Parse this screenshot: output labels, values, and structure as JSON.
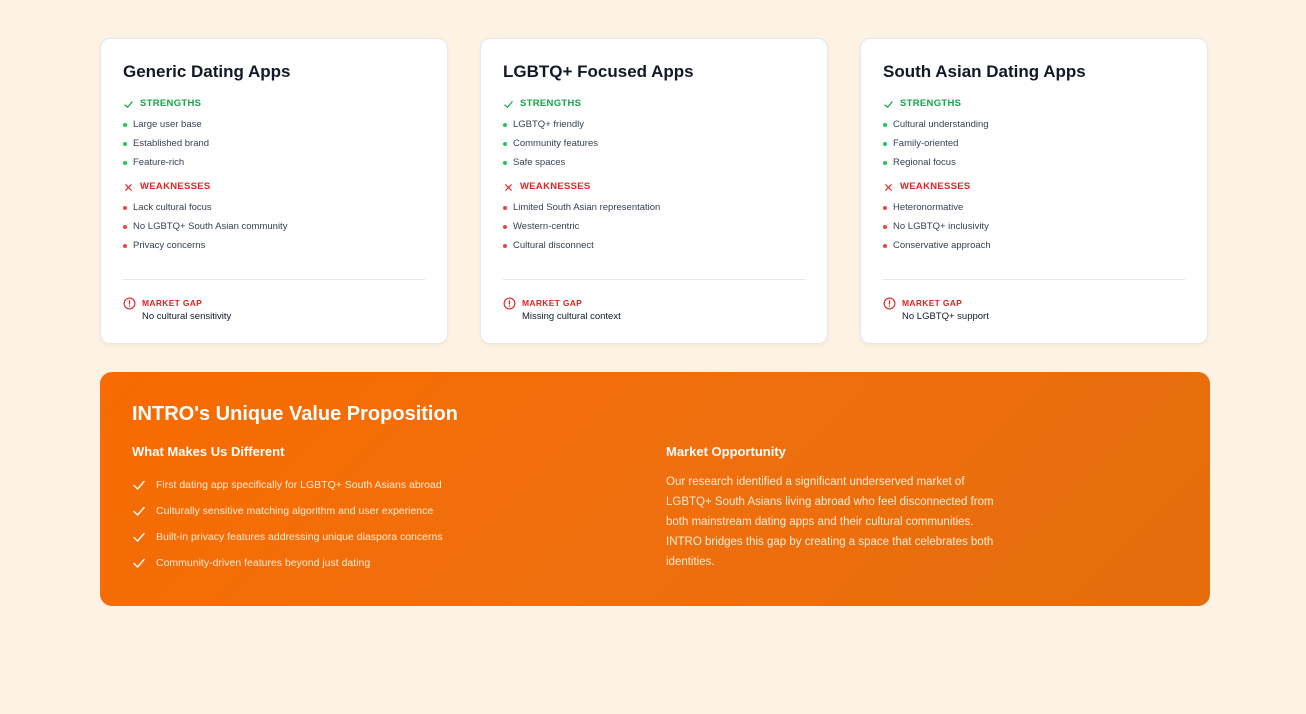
{
  "cards": [
    {
      "title": "Generic Dating Apps",
      "strengths_label": "STRENGTHS",
      "strengths": [
        "Large user base",
        "Established brand",
        "Feature-rich"
      ],
      "weaknesses_label": "WEAKNESSES",
      "weaknesses": [
        "Lack cultural focus",
        "No LGBTQ+ South Asian community",
        "Privacy concerns"
      ],
      "gap_label": "MARKET GAP",
      "gap_text": "No cultural sensitivity"
    },
    {
      "title": "LGBTQ+ Focused Apps",
      "strengths_label": "STRENGTHS",
      "strengths": [
        "LGBTQ+ friendly",
        "Community features",
        "Safe spaces"
      ],
      "weaknesses_label": "WEAKNESSES",
      "weaknesses": [
        "Limited South Asian representation",
        "Western-centric",
        "Cultural disconnect"
      ],
      "gap_label": "MARKET GAP",
      "gap_text": "Missing cultural context"
    },
    {
      "title": "South Asian Dating Apps",
      "strengths_label": "STRENGTHS",
      "strengths": [
        "Cultural understanding",
        "Family-oriented",
        "Regional focus"
      ],
      "weaknesses_label": "WEAKNESSES",
      "weaknesses": [
        "Heteronormative",
        "No LGBTQ+ inclusivity",
        "Conservative approach"
      ],
      "gap_label": "MARKET GAP",
      "gap_text": "No LGBTQ+ support"
    }
  ],
  "value_prop": {
    "title": "INTRO's Unique Value Proposition",
    "different_heading": "What Makes Us Different",
    "different_items": [
      "First dating app specifically for LGBTQ+ South Asians abroad",
      "Culturally sensitive matching algorithm and user experience",
      "Built-in privacy features addressing unique diaspora concerns",
      "Community-driven features beyond just dating"
    ],
    "opportunity_heading": "Market Opportunity",
    "opportunity_text": "Our research identified a significant underserved market of LGBTQ+ South Asians living abroad who feel disconnected from both mainstream dating apps and their cultural communities. INTRO bridges this gap by creating a space that celebrates both identities."
  },
  "colors": {
    "accent_orange": "#f76b00",
    "strength_green": "#16a34a",
    "weakness_red": "#dc2626",
    "background": "#fdf2e4"
  },
  "icons": {
    "strength": "check-icon",
    "weakness": "x-icon",
    "gap": "alert-circle-icon",
    "value_item": "check-icon"
  }
}
